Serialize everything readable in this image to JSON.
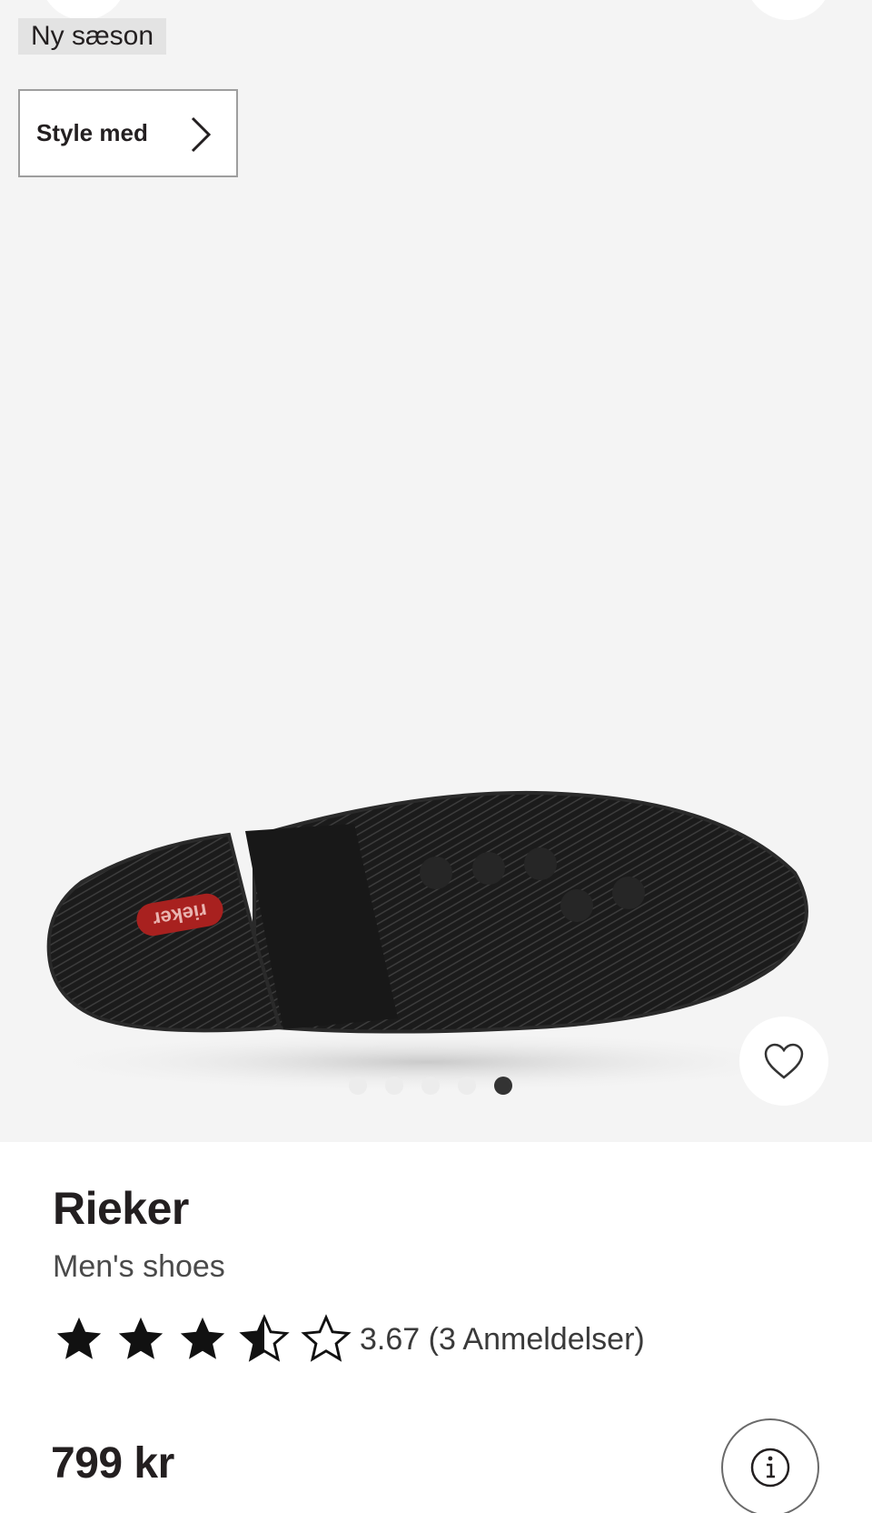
{
  "gallery": {
    "badge": "Ny sæson",
    "style_button_label": "Style med",
    "slide_count": 5,
    "active_slide": 5,
    "image_logo_text": "rieker"
  },
  "product": {
    "brand": "Rieker",
    "category": "Men's shoes",
    "rating_value": 3.67,
    "rating_text": "3.67 (3 Anmeldelser)",
    "price": "799 kr"
  },
  "icons": {
    "style_chevron": "chevron-right-icon",
    "favorite": "heart-icon",
    "info": "info-icon",
    "star": "star-icon"
  },
  "colors": {
    "text": "#231f20",
    "gallery_bg": "#f4f4f4",
    "badge_bg": "#e3e3e3",
    "star": "#111111",
    "logo_red": "#a8211f"
  }
}
